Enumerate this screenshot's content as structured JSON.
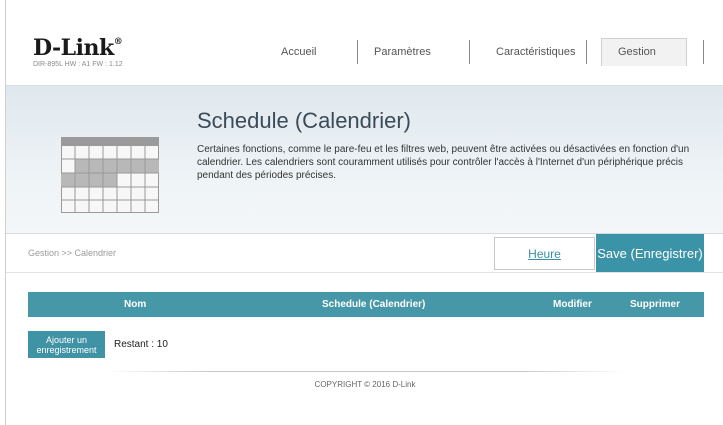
{
  "header": {
    "logo": "D-Link",
    "logo_mark": "®",
    "model_info": "DIR-895L  HW : A1  FW : 1.12",
    "nav": [
      {
        "label": "Accueil"
      },
      {
        "label": "Paramètres"
      },
      {
        "label": "Caractéristiques"
      },
      {
        "label": "Gestion"
      }
    ]
  },
  "banner": {
    "title": "Schedule (Calendrier)",
    "description": "Certaines fonctions, comme le pare-feu et les filtres web, peuvent être activées ou désactivées en fonction d'un calendrier. Les calendriers sont couramment utilisés pour contrôler l'accès à l'Internet d'un périphérique précis pendant des périodes précises.",
    "icon": "calendar-icon"
  },
  "toolbar": {
    "breadcrumb": "Gestion >> Calendrier",
    "heure_label": "Heure",
    "save_label": "Save (Enregistrer)"
  },
  "table": {
    "columns": [
      "Nom",
      "Schedule (Calendrier)",
      "Modifier",
      "Supprimer"
    ]
  },
  "actions": {
    "add_label": "Ajouter un enregistrement",
    "remaining": "Restant : 10"
  },
  "footer": {
    "copyright": "COPYRIGHT © 2016 D-Link"
  },
  "colors": {
    "accent": "#3a93a6",
    "table_header": "#4697a8",
    "link": "#3a8fa8"
  }
}
